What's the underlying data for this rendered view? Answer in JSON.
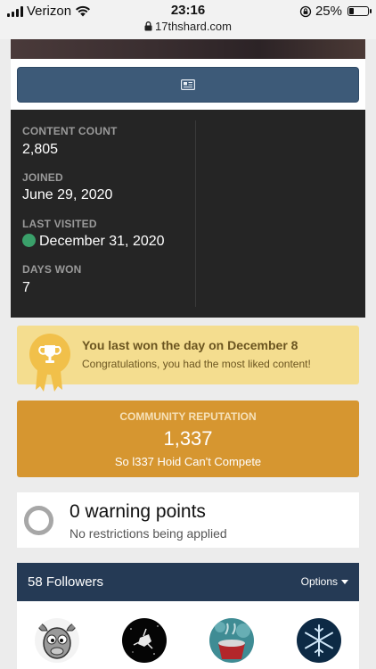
{
  "status_bar": {
    "carrier": "Verizon",
    "time": "23:16",
    "url": "17thshard.com",
    "battery": "25%",
    "battery_level": 0.25
  },
  "profile": {
    "feed_button_icon": "activity-feed-icon"
  },
  "stats": [
    {
      "label": "CONTENT COUNT",
      "value": "2,805"
    },
    {
      "label": "JOINED",
      "value": "June 29, 2020"
    },
    {
      "label": "LAST VISITED",
      "value": "December 31, 2020"
    },
    {
      "label": "DAYS WON",
      "value": "7"
    }
  ],
  "day_won": {
    "title": "You last won the day on December 8",
    "subtitle": "Congratulations, you had the most liked content!"
  },
  "reputation": {
    "title": "COMMUNITY REPUTATION",
    "value": "1,337",
    "rank": "So l337 Hoid Can't Compete"
  },
  "warnings": {
    "title": "0 warning points",
    "subtitle": "No restrictions being applied"
  },
  "followers": {
    "title": "58 Followers",
    "options_label": "Options"
  },
  "colors": {
    "feed_button": "#3d5a78",
    "stats_bg": "#252525",
    "online": "#3aa06a",
    "day_won_bg": "#f4dd8f",
    "reputation_bg": "#d69630",
    "followers_header": "#253a55"
  }
}
